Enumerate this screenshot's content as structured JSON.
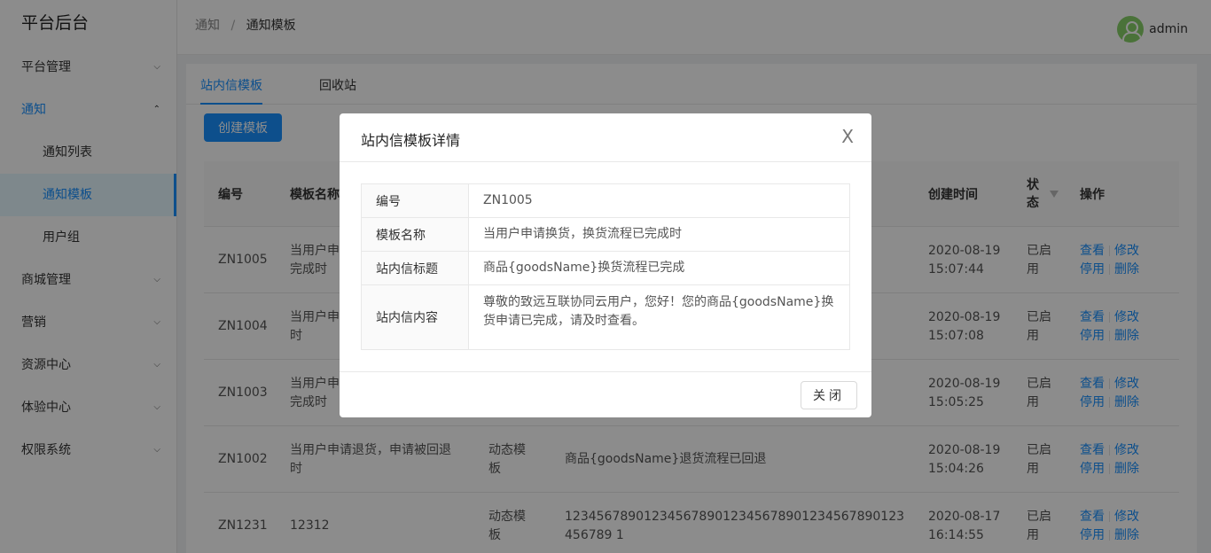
{
  "brand": "平台后台",
  "sidebar": {
    "items": [
      {
        "label": "平台管理"
      },
      {
        "label": "通知"
      },
      {
        "label": "通知列表"
      },
      {
        "label": "通知模板"
      },
      {
        "label": "用户组"
      },
      {
        "label": "商城管理"
      },
      {
        "label": "营销"
      },
      {
        "label": "资源中心"
      },
      {
        "label": "体验中心"
      },
      {
        "label": "权限系统"
      }
    ]
  },
  "header": {
    "breadcrumb": [
      "通知",
      "通知模板"
    ],
    "separator": "/",
    "user": "admin"
  },
  "tabs": [
    "站内信模板",
    "回收站"
  ],
  "create_button": "创建模板",
  "table": {
    "columns": [
      "编号",
      "模板名称",
      "创建时间",
      "状态",
      "操作"
    ],
    "rows": [
      {
        "id": "ZN1005",
        "name": "当用户申请换货，换货流程已完成时",
        "type": "",
        "title": "",
        "date": "2020-08-19",
        "time": "15:07:44",
        "status": "已启用"
      },
      {
        "id": "ZN1004",
        "name": "当用户申请换货，申请被回退时",
        "type": "",
        "title": "",
        "date": "2020-08-19",
        "time": "15:07:08",
        "status": "已启用"
      },
      {
        "id": "ZN1003",
        "name": "当用户申请退货，退货流程已完成时",
        "type": "",
        "title": "",
        "date": "2020-08-19",
        "time": "15:05:25",
        "status": "已启用"
      },
      {
        "id": "ZN1002",
        "name": "当用户申请退货，申请被回退时",
        "type": "动态模板",
        "title": "商品{goodsName}退货流程已回退",
        "date": "2020-08-19",
        "time": "15:04:26",
        "status": "已启用"
      },
      {
        "id": "ZN1231",
        "name": "12312",
        "type": "动态模板",
        "title": "1234567890123456789012345678901234567890123456789 1",
        "date": "2020-08-17",
        "time": "16:14:55",
        "status": "已启用"
      }
    ],
    "ops": {
      "view": "查看",
      "edit": "修改",
      "disable": "停用",
      "delete": "删除"
    }
  },
  "modal": {
    "title": "站内信模板详情",
    "close_icon": "X",
    "fields": [
      {
        "label": "编号",
        "value": "ZN1005"
      },
      {
        "label": "模板名称",
        "value": "当用户申请换货，换货流程已完成时"
      },
      {
        "label": "站内信标题",
        "value": "商品{goodsName}换货流程已完成"
      },
      {
        "label": "站内信内容",
        "value": "尊敬的致远互联协同云用户，您好！您的商品{goodsName}换货申请已完成，请及时查看。"
      }
    ],
    "close_button": "关闭"
  },
  "colors": {
    "accent": "#1890ff",
    "avatar": "#87d068"
  }
}
